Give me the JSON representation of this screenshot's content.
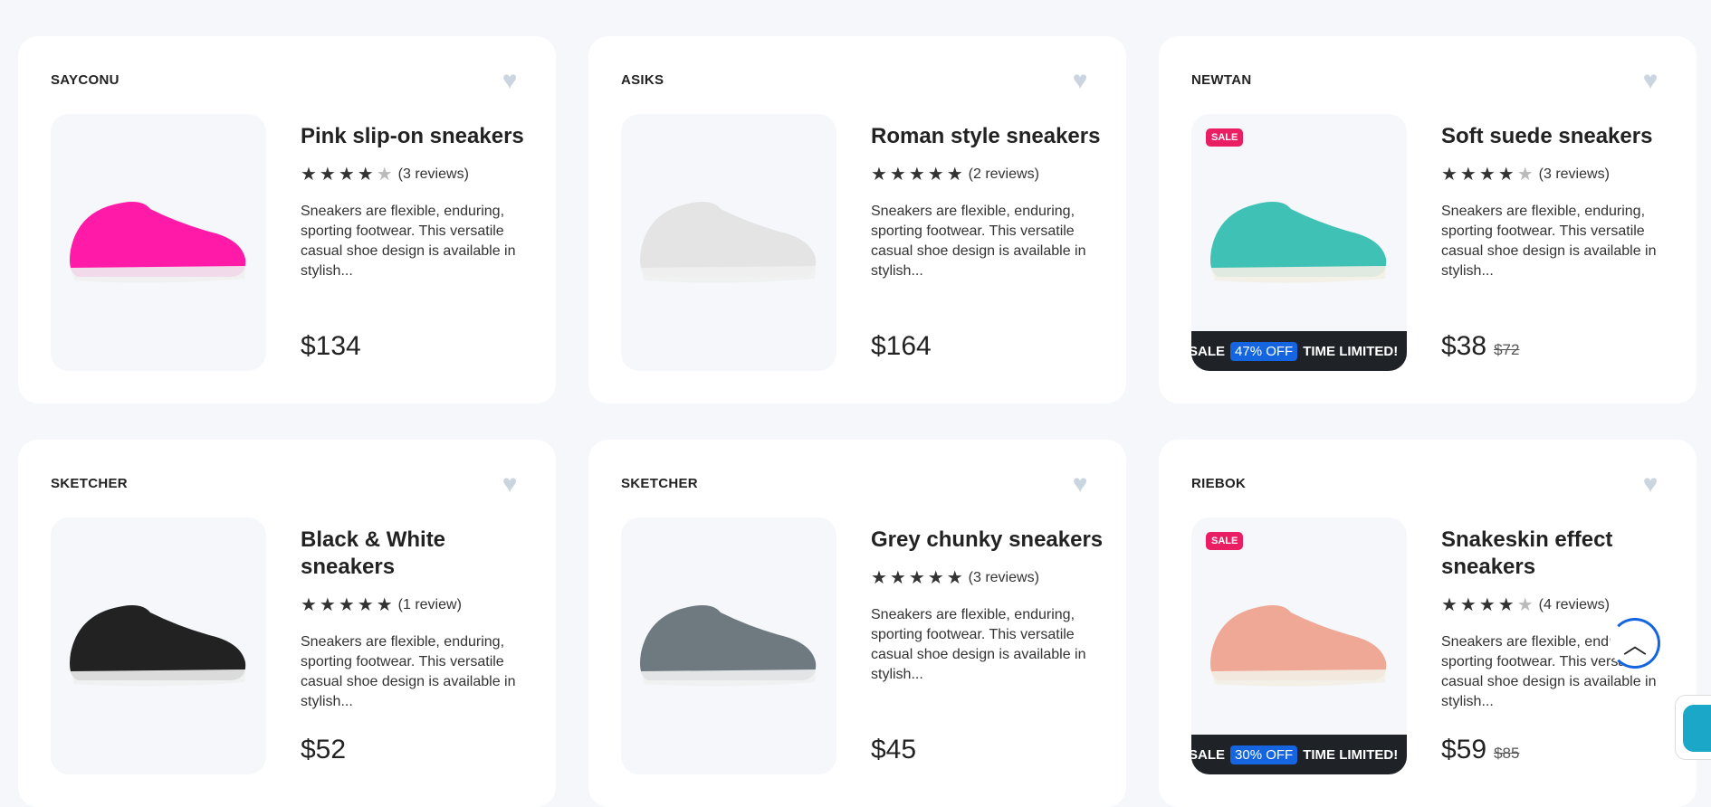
{
  "products": [
    {
      "brand": "SAYCONU",
      "title": "Pink slip-on sneakers",
      "stars": "★★★★",
      "stars_off": "★",
      "reviews": "(3 reviews)",
      "desc": "Sneakers are flexible, enduring, sporting footwear. This versatile casual shoe design is available in stylish...",
      "price": "$134",
      "old_price": "",
      "sale": false,
      "shoe_color": "#ff1aa8"
    },
    {
      "brand": "ASIKS",
      "title": "Roman style sneakers",
      "stars": "★★★★★",
      "stars_off": "",
      "reviews": "(2 reviews)",
      "desc": "Sneakers are flexible, enduring, sporting footwear. This versatile casual shoe design is available in stylish...",
      "price": "$164",
      "old_price": "",
      "sale": false,
      "shoe_color": "#e4e4e4"
    },
    {
      "brand": "NEWTAN",
      "title": "Soft suede sneakers",
      "stars": "★★★★",
      "stars_off": "★",
      "reviews": "(3 reviews)",
      "desc": "Sneakers are flexible, enduring, sporting footwear. This versatile casual shoe design is available in stylish...",
      "price": "$38",
      "old_price": "$72",
      "sale": true,
      "sale_badge": "SALE",
      "banner_left": "SALE",
      "banner_pct": "47% OFF",
      "banner_right": "TIME LIMITED!",
      "shoe_color": "#3fc2b5"
    },
    {
      "brand": "SKETCHER",
      "title": "Black & White sneakers",
      "stars": "★★★★★",
      "stars_off": "",
      "reviews": "(1 review)",
      "desc": "Sneakers are flexible, enduring, sporting footwear. This versatile casual shoe design is available in stylish...",
      "price": "$52",
      "old_price": "",
      "sale": false,
      "shoe_color": "#222"
    },
    {
      "brand": "SKETCHER",
      "title": "Grey chunky sneakers",
      "stars": "★★★★★",
      "stars_off": "",
      "reviews": "(3 reviews)",
      "desc": "Sneakers are flexible, enduring, sporting footwear. This versatile casual shoe design is available in stylish...",
      "price": "$45",
      "old_price": "",
      "sale": false,
      "shoe_color": "#6e7a80"
    },
    {
      "brand": "RIEBOK",
      "title": "Snakeskin effect sneakers",
      "stars": "★★★★",
      "stars_off": "★",
      "reviews": "(4 reviews)",
      "desc": "Sneakers are flexible, enduring, sporting footwear. This versatile casual shoe design is available in stylish...",
      "price": "$59",
      "old_price": "$85",
      "sale": true,
      "sale_badge": "SALE",
      "banner_left": "SALE",
      "banner_pct": "30% OFF",
      "banner_right": "TIME LIMITED!",
      "shoe_color": "#f0a896"
    }
  ],
  "heart_icon": "heart-icon",
  "scroll_top_icon": "chevron-up-icon",
  "scroll_top_glyph": "︿",
  "heart_glyph": "♥",
  "colors": {
    "accent": "#1565e0",
    "sale": "#e91e63",
    "banner": "#1f2328",
    "background": "#f5f7fa"
  }
}
